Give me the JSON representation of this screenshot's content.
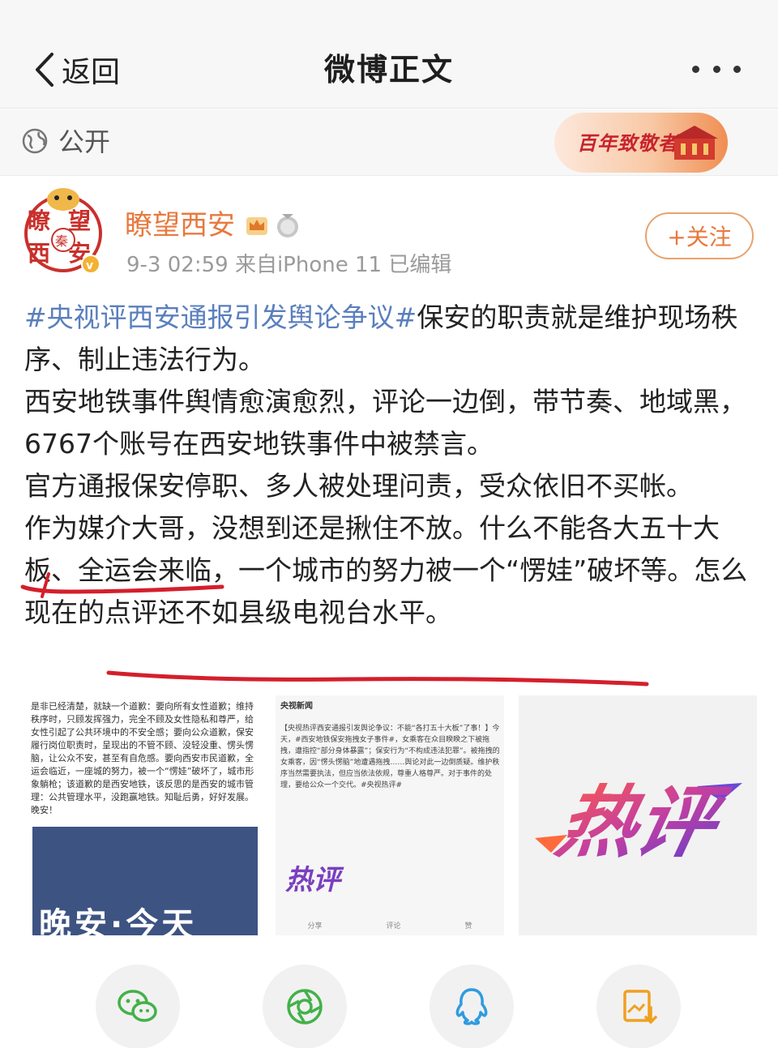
{
  "nav": {
    "back_label": "返回",
    "title": "微博正文"
  },
  "visibility": {
    "label": "公开",
    "banner_text": "百年致敬者"
  },
  "author": {
    "name": "瞭望西安",
    "timestamp": "9-3 02:59",
    "source": "来自iPhone 11",
    "edited": "已编辑",
    "follow_label": "+关注",
    "avatar_text": "瞭望西安"
  },
  "post": {
    "hashtag": "#央视评西安通报引发舆论争议#",
    "line1_rest": "保安的职责就是维护现场秩序、制止违法行为。",
    "paragraph2": "西安地铁事件舆情愈演愈烈，评论一边倒，带节奏、地域黑，6767个账号在西安地铁事件中被禁言。",
    "paragraph3": "官方通报保安停职、多人被处理问责，受众依旧不买帐。",
    "paragraph4_a": "作为媒介大哥",
    "paragraph4_b": "，没想到还是揪住不放。什么不能各大五十大板、全运会来临，一个城市的努力被一个“愣娃”破坏等。",
    "paragraph4_c": "怎么现在的点评还不如县级电视台水平",
    "paragraph4_d": "。"
  },
  "images": {
    "thumb1_text": "是非已经清楚，就缺一个道歉：要向所有女性道歉；维持秩序时，只顾发挥强力，完全不顾及女性隐私和尊严，给女性引起了公共环境中的不安全感；要向公众道歉，保安履行岗位职责时，呈现出的不管不顾、没轻没重、愣头愣脑，让公众不安，甚至有自危感。要向西安市民道歉，全运会临近，一座城的努力，被一个“愣娃”破坏了，城市形象躺枪；该道歉的是西安地铁，该反思的是西安的城市管理：公共管理水平，没跑赢地铁。知耻后勇，好好发展。晚安！",
    "thumb1_banner": "晚安·今天",
    "thumb2_source": "央视新闻",
    "thumb2_text": "【央视热评西安通报引发舆论争议：不能“各打五十大板”了事！】今天，#西安地铁保安拖拽女子事件#，女乘客在众目睽睽之下被拖拽，遭指控“部分身体暴露”；保安行为“不构成违法犯罪”。被拖拽的女乘客，因“愣头愣脑”地遭遇拖拽……舆论对此一边倒质疑。维护秩序当然需要执法，但应当依法依规，尊重人格尊严。对于事件的处理，要给公众一个交代。#央视热评#",
    "thumb2_logo": "热评",
    "thumb2_actions": [
      "分享",
      "评论",
      "赞"
    ],
    "thumb3_logo": "热评"
  },
  "share": {
    "wechat": "wechat-icon",
    "moments": "moments-icon",
    "qq": "qq-icon",
    "save": "save-image-icon"
  },
  "colors": {
    "hashtag": "#5a7fbe",
    "author": "#e8793e",
    "underline": "#d41f2b"
  }
}
